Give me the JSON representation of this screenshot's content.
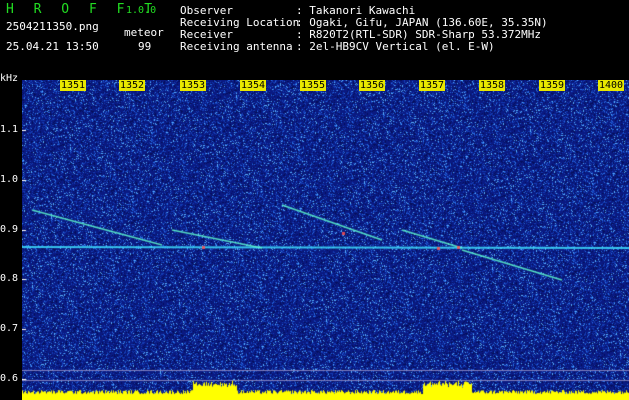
{
  "app": {
    "title": "H R O F F T",
    "version": "1.0.0"
  },
  "file": {
    "name": "2504211350.png",
    "datetime": "25.04.21 13:50"
  },
  "meteor": {
    "label": "meteor",
    "count": "99"
  },
  "info": {
    "observer_key": "Observer",
    "observer_val": ": Takanori Kawachi",
    "location_key": "Receiving Location",
    "location_val": ": Ogaki, Gifu, JAPAN (136.60E, 35.35N)",
    "receiver_key": "Receiver",
    "receiver_val": ": R820T2(RTL-SDR) SDR-Sharp 53.372MHz",
    "antenna_key": "Receiving antenna",
    "antenna_val": ": 2el-HB9CV Vertical (el. E-W)"
  },
  "axis": {
    "unit": "kHz",
    "y_ticks": [
      "1.1",
      "1.0",
      "0.9",
      "0.8",
      "0.7",
      "0.6"
    ],
    "time_ticks": [
      "1351",
      "1352",
      "1353",
      "1354",
      "1355",
      "1356",
      "1357",
      "1358",
      "1359",
      "1400"
    ]
  },
  "colors": {
    "background": "#0a1a8a",
    "carrier": "#40e0ff",
    "histogram": "#ffff00",
    "label": "#22dd22"
  }
}
